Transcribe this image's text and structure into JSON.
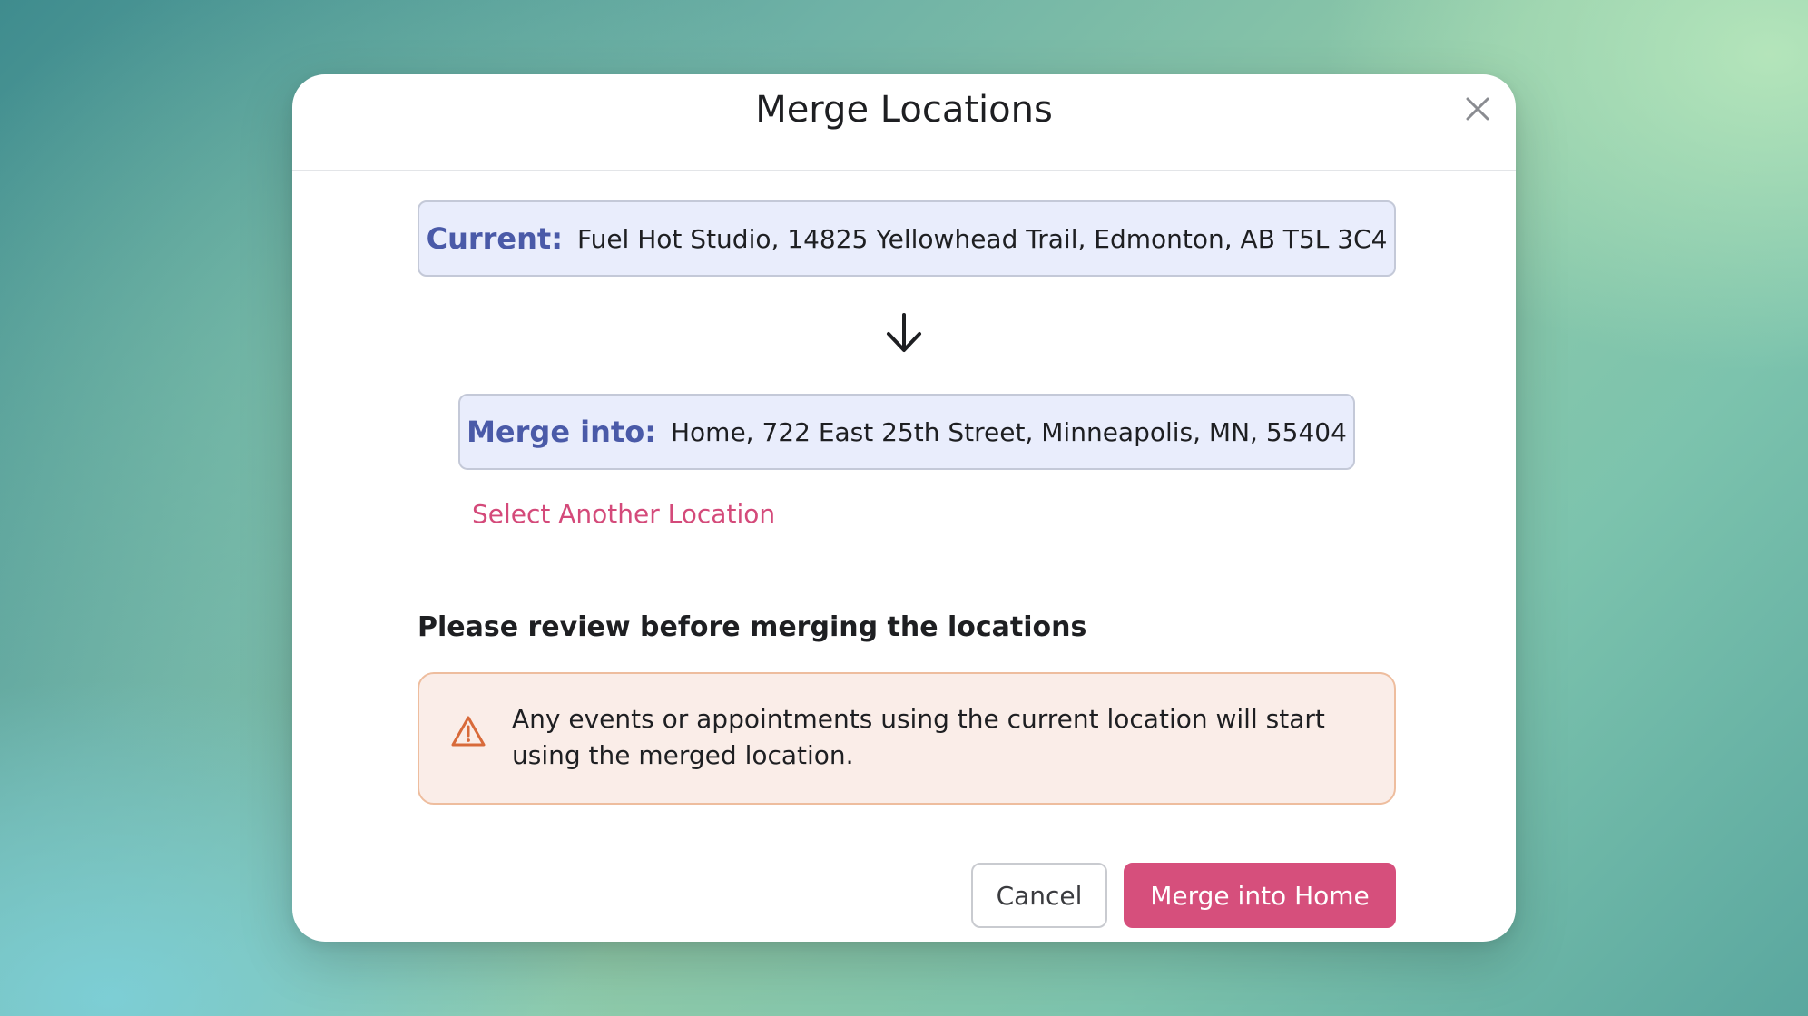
{
  "modal": {
    "title": "Merge Locations",
    "close_icon": "close-icon"
  },
  "current": {
    "label": "Current:",
    "value": "Fuel Hot Studio, 14825 Yellowhead Trail, Edmonton, AB T5L 3C4"
  },
  "arrow_icon": "arrow-down-icon",
  "merge_into": {
    "label": "Merge into:",
    "value": "Home, 722 East 25th Street, Minneapolis, MN, 55404"
  },
  "select_another_label": "Select Another Location",
  "review": {
    "heading": "Please review before merging the locations",
    "warning_icon": "warning-triangle-icon",
    "warning_text": "Any events or appointments using the current location will start using the merged location."
  },
  "actions": {
    "cancel_label": "Cancel",
    "merge_label": "Merge into Home"
  },
  "colors": {
    "accent": "#d64f7c",
    "label_blue": "#4a5aa8",
    "location_box_bg": "#e9edfc",
    "warning_bg": "#faede8",
    "warning_border": "#eebd9e",
    "warning_icon": "#d86a3a"
  }
}
